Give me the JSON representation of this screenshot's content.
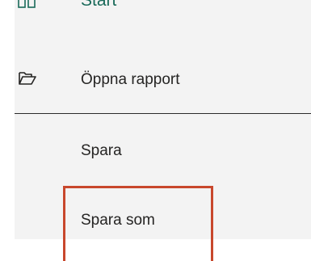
{
  "menu": {
    "start": {
      "label": "Start",
      "icon": "layout-icon"
    },
    "items": [
      {
        "label": "Öppna rapport",
        "icon": "folder-open-icon"
      },
      {
        "label": "Spara"
      },
      {
        "label": "Spara som"
      }
    ]
  },
  "highlight": {
    "color": "#c8472c",
    "target": "Spara som"
  }
}
